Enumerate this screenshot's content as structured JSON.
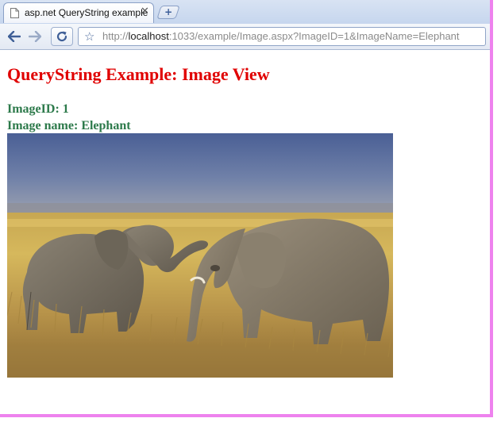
{
  "browser": {
    "tab": {
      "title": "asp.net QueryString example",
      "close_glyph": "✕",
      "favicon": "page-icon"
    },
    "new_tab_glyph": "+",
    "address_bar": {
      "scheme": "http://",
      "host": "localhost",
      "rest": ":1033/example/Image.aspx?ImageID=1&ImageName=Elephant"
    },
    "icons": [
      "back-arrow-icon",
      "forward-arrow-icon",
      "reload-icon",
      "bookmark-star-icon"
    ]
  },
  "page": {
    "title": "QueryString Example: Image View",
    "image_id_label": "ImageID: 1",
    "image_name_label": "Image name: Elephant",
    "photo_subject": "elephant-photo"
  },
  "colors": {
    "title": "#e00000",
    "info_text": "#2d7a4b",
    "window_border": "#ee82ee"
  }
}
